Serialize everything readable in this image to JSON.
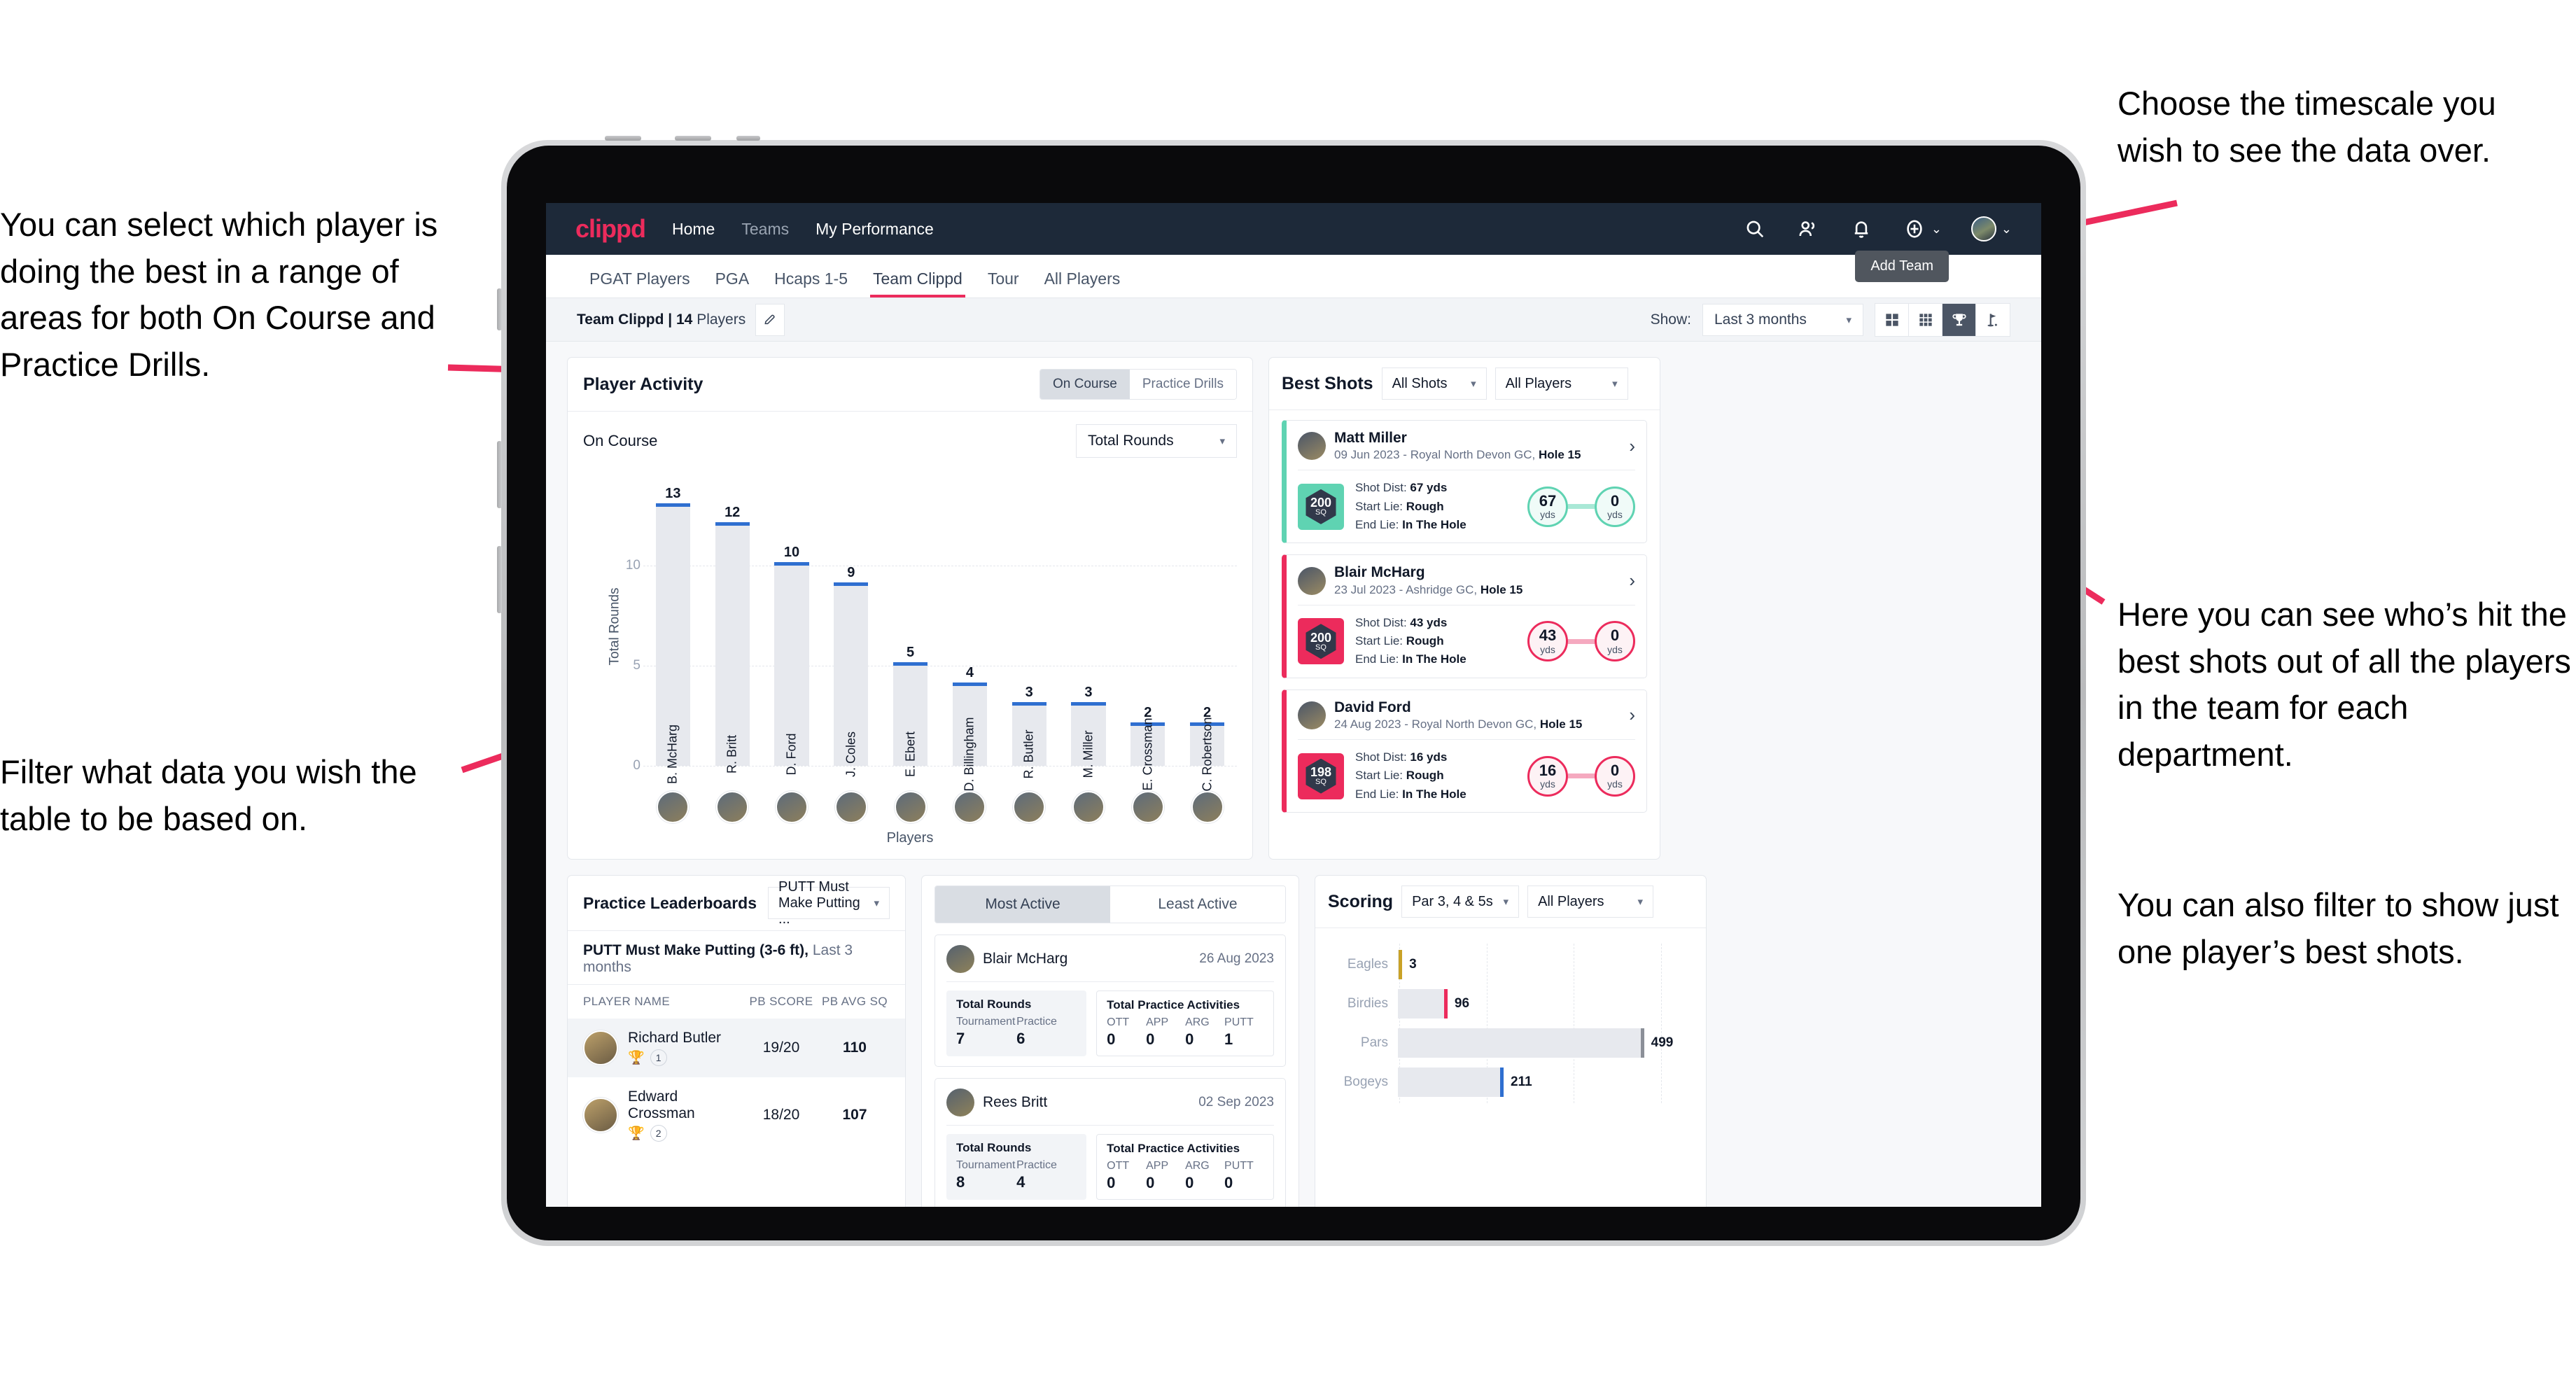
{
  "annotations": {
    "left_top": "You can select which player is doing the best in a range of areas for both On Course and Practice Drills.",
    "left_bottom": "Filter what data you wish the table to be based on.",
    "right_top": "Choose the timescale you wish to see the data over.",
    "right_middle": "Here you can see who’s hit the best shots out of all the players in the team for each department.",
    "right_bottom": "You can also filter to show just one player’s best shots."
  },
  "topnav": {
    "logo": "clippd",
    "links": [
      {
        "label": "Home",
        "active": true
      },
      {
        "label": "Teams",
        "active": false
      },
      {
        "label": "My Performance",
        "active": true
      }
    ],
    "icons": [
      "search-icon",
      "people-icon",
      "bell-icon",
      "plus-circle-icon",
      "avatar"
    ],
    "add_caret": "⌄",
    "avatar_caret": "⌄"
  },
  "tabs": {
    "items": [
      {
        "label": "PGAT Players",
        "active": false
      },
      {
        "label": "PGA",
        "active": false
      },
      {
        "label": "Hcaps 1-5",
        "active": false
      },
      {
        "label": "Team Clippd",
        "active": true
      },
      {
        "label": "Tour",
        "active": false
      },
      {
        "label": "All Players",
        "active": false
      }
    ],
    "tooltip": "Add Team"
  },
  "subbar": {
    "team_label_bold": "Team Clippd | 14",
    "team_label_light": " Players",
    "edit_icon": "pencil-icon",
    "show_label": "Show:",
    "timescale": "Last 3 months",
    "views": [
      {
        "icon": "grid-2x2-icon",
        "active": false
      },
      {
        "icon": "grid-3x3-icon",
        "active": false
      },
      {
        "icon": "trophy-icon",
        "active": true
      },
      {
        "icon": "golf-flag-icon",
        "active": false
      }
    ]
  },
  "player_activity": {
    "title": "Player Activity",
    "segments": [
      {
        "label": "On Course",
        "active": true
      },
      {
        "label": "Practice Drills",
        "active": false
      }
    ],
    "sub_label": "On Course",
    "metric": "Total Rounds"
  },
  "chart_data": [
    {
      "type": "bar",
      "title": "Player Activity – On Course",
      "categories": [
        "B. McHarg",
        "R. Britt",
        "D. Ford",
        "J. Coles",
        "E. Ebert",
        "D. Billingham",
        "R. Butler",
        "M. Miller",
        "E. Crossman",
        "C. Robertson"
      ],
      "values": [
        13,
        12,
        10,
        9,
        5,
        4,
        3,
        3,
        2,
        2
      ],
      "xlabel": "Players",
      "ylabel": "Total Rounds",
      "ylim": [
        0,
        14
      ],
      "yticks": [
        0,
        5,
        10
      ],
      "grid": true,
      "bar_color": "#e7e9ee",
      "cap_color": "#2f6fd0"
    },
    {
      "type": "bar",
      "orientation": "horizontal",
      "title": "Scoring",
      "categories": [
        "Eagles",
        "Birdies",
        "Pars",
        "Bogeys"
      ],
      "values": [
        3,
        96,
        499,
        211
      ],
      "xlim": [
        0,
        600
      ],
      "grid": true,
      "cap_colors": [
        "#c9a227",
        "#ec2b5c",
        "#8b8f98",
        "#2f6fd0"
      ]
    }
  ],
  "best_shots": {
    "title": "Best Shots",
    "filter_shots": "All Shots",
    "filter_players": "All Players",
    "items": [
      {
        "name": "Matt Miller",
        "meta_plain": "09 Jun 2023 - Royal North Devon GC, ",
        "meta_bold": "Hole 15",
        "sq": "200",
        "sq_unit": "SQ",
        "accent": "teal",
        "shot_dist_label": "Shot Dist: ",
        "shot_dist": "67 yds",
        "start_lie_label": "Start Lie: ",
        "start_lie": "Rough",
        "end_lie_label": "End Lie: ",
        "end_lie": "In The Hole",
        "from_val": "67",
        "from_unit": "yds",
        "to_val": "0",
        "to_unit": "yds"
      },
      {
        "name": "Blair McHarg",
        "meta_plain": "23 Jul 2023 - Ashridge GC, ",
        "meta_bold": "Hole 15",
        "sq": "200",
        "sq_unit": "SQ",
        "accent": "pink",
        "shot_dist_label": "Shot Dist: ",
        "shot_dist": "43 yds",
        "start_lie_label": "Start Lie: ",
        "start_lie": "Rough",
        "end_lie_label": "End Lie: ",
        "end_lie": "In The Hole",
        "from_val": "43",
        "from_unit": "yds",
        "to_val": "0",
        "to_unit": "yds"
      },
      {
        "name": "David Ford",
        "meta_plain": "24 Aug 2023 - Royal North Devon GC, ",
        "meta_bold": "Hole 15",
        "sq": "198",
        "sq_unit": "SQ",
        "accent": "pink",
        "shot_dist_label": "Shot Dist: ",
        "shot_dist": "16 yds",
        "start_lie_label": "Start Lie: ",
        "start_lie": "Rough",
        "end_lie_label": "End Lie: ",
        "end_lie": "In The Hole",
        "from_val": "16",
        "from_unit": "yds",
        "to_val": "0",
        "to_unit": "yds"
      }
    ]
  },
  "practice_leaderboards": {
    "title": "Practice Leaderboards",
    "drill_select": "PUTT Must Make Putting ...",
    "sub_bold": "PUTT Must Make Putting (3-6 ft),",
    "sub_light": " Last 3 months",
    "columns": [
      "PLAYER NAME",
      "PB SCORE",
      "PB AVG SQ"
    ],
    "rows": [
      {
        "name": "Richard Butler",
        "rank": "1",
        "trophy": "gold",
        "score": "19/20",
        "avg": "110"
      },
      {
        "name": "Edward Crossman",
        "rank": "2",
        "trophy": "silver",
        "score": "18/20",
        "avg": "107"
      }
    ]
  },
  "activity": {
    "tabs": [
      {
        "label": "Most Active",
        "active": true
      },
      {
        "label": "Least Active",
        "active": false
      }
    ],
    "rounds_title": "Total Rounds",
    "rounds_keys": [
      "Tournament",
      "Practice"
    ],
    "practice_title": "Total Practice Activities",
    "practice_keys": [
      "OTT",
      "APP",
      "ARG",
      "PUTT"
    ],
    "items": [
      {
        "name": "Blair McHarg",
        "date": "26 Aug 2023",
        "rounds": [
          "7",
          "6"
        ],
        "practice": [
          "0",
          "0",
          "0",
          "1"
        ]
      },
      {
        "name": "Rees Britt",
        "date": "02 Sep 2023",
        "rounds": [
          "8",
          "4"
        ],
        "practice": [
          "0",
          "0",
          "0",
          "0"
        ]
      }
    ]
  },
  "scoring": {
    "title": "Scoring",
    "filter_par": "Par 3, 4 & 5s",
    "filter_players": "All Players"
  }
}
